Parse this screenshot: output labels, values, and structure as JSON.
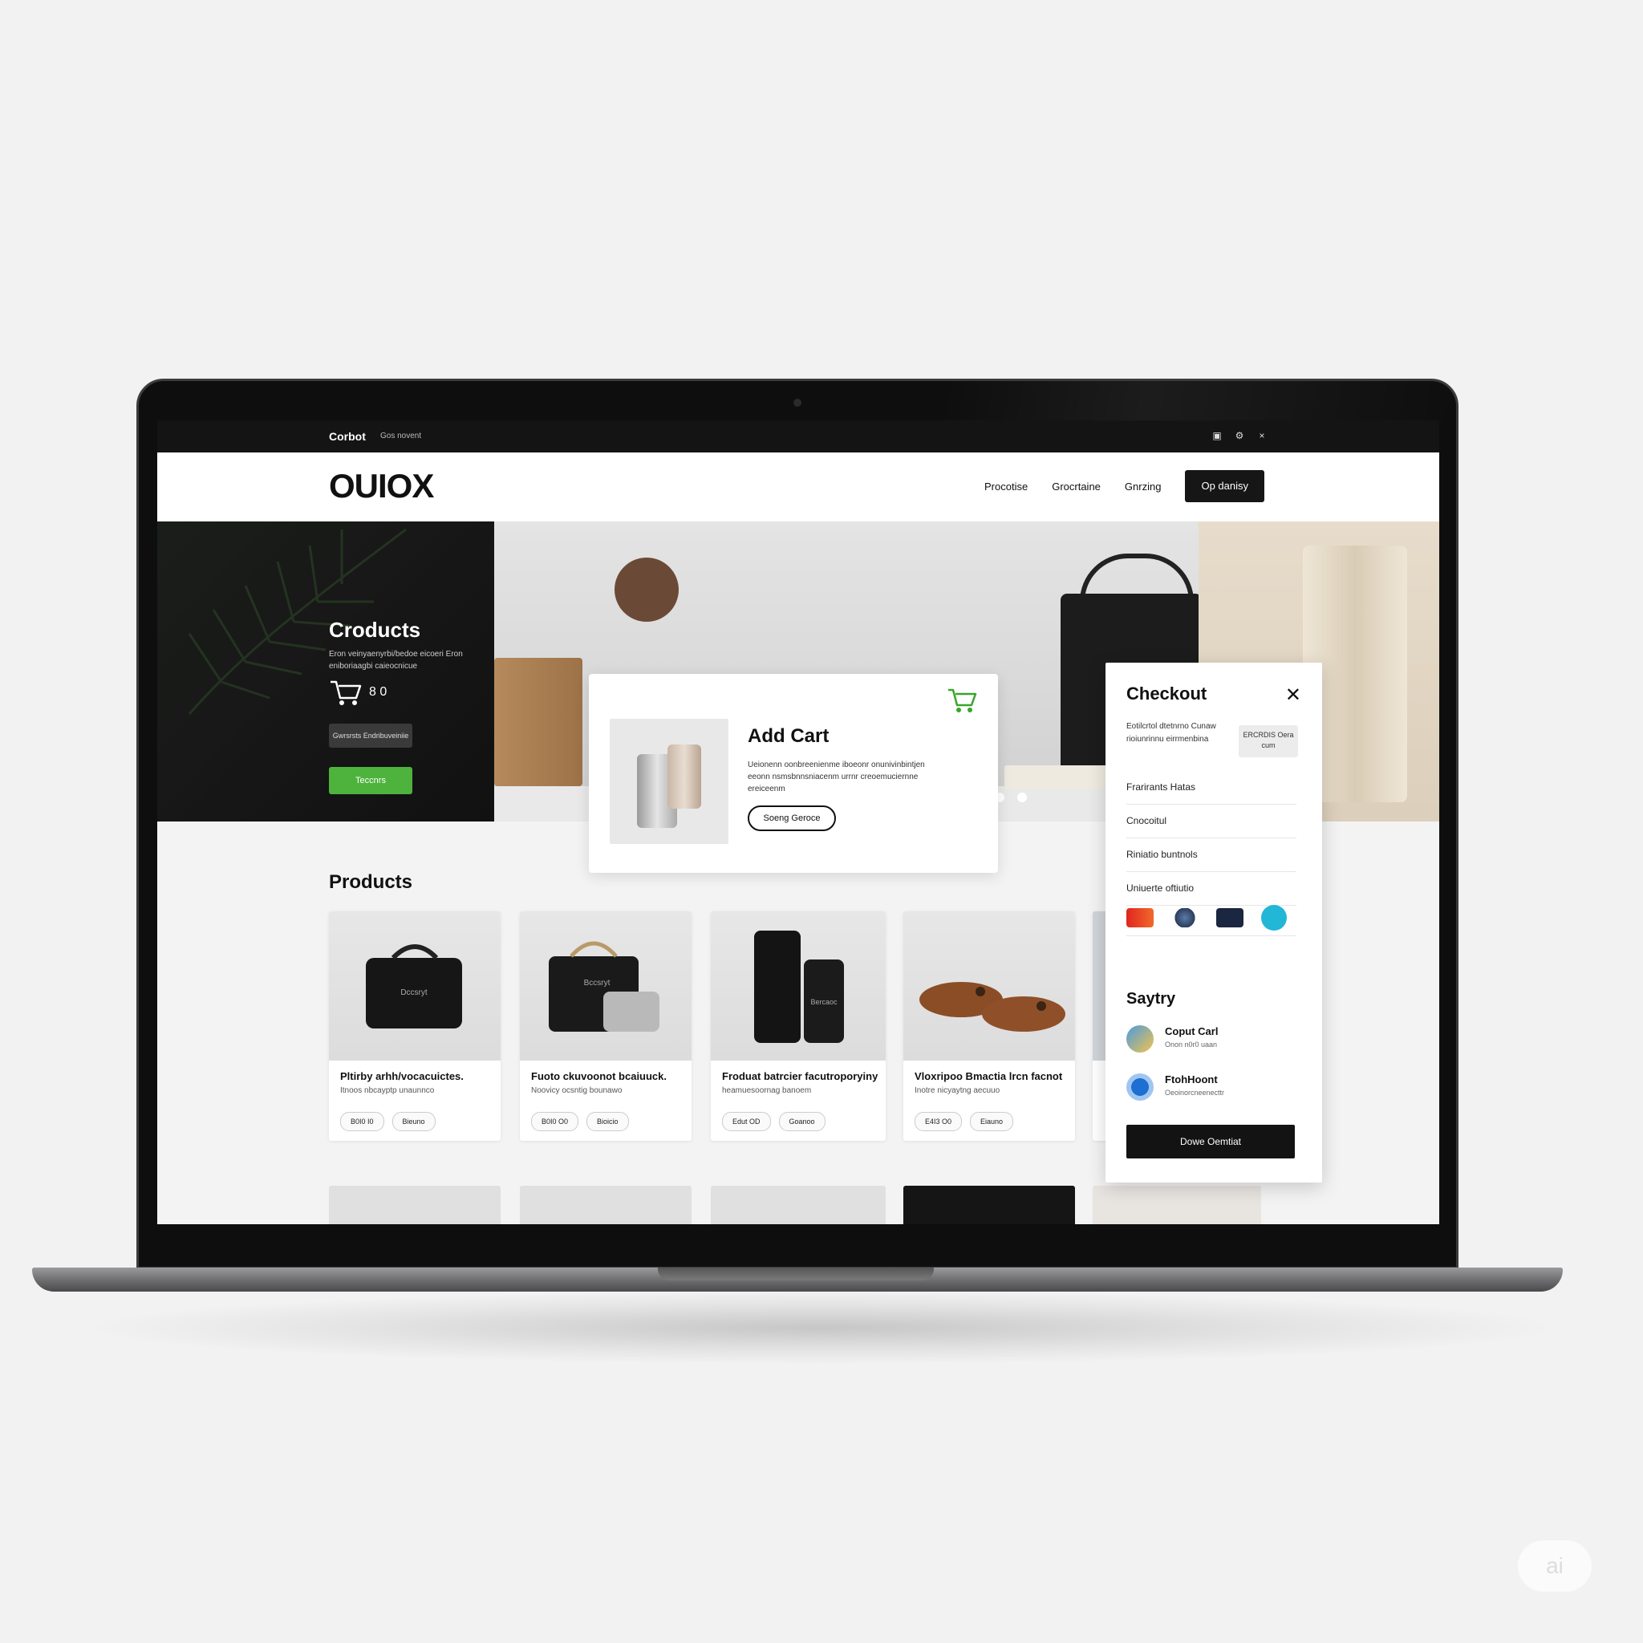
{
  "topbar": {
    "brand": "Corbot",
    "tagline": "Gos novent"
  },
  "header": {
    "logo": "OUIOX",
    "nav": [
      "Procotise",
      "Grocrtaine",
      "Gnrzing"
    ],
    "cta": "Op danisy"
  },
  "hero": {
    "title": "Croducts",
    "subtitle": "Eron veinyaenyrbi/bedoe eicoeri Eron eniboriaagbi caieocnicue",
    "cart_count": "8 0",
    "badge": "Gwrsrsts Endribuveiniie",
    "green_button": "Teccnrs",
    "carousel": {
      "slides": 5,
      "active": 2
    }
  },
  "addcart": {
    "title": "Add Cart",
    "description": "Ueionenn oonbreenienme iboeonr onunivinbintjen eeonn nsmsbnnsniacenm urrnr creoemuciernne ereiceenm",
    "button": "Soeng Geroce"
  },
  "products": {
    "title": "Products",
    "items": [
      {
        "name": "Pltirby arhh/vocacuictes.",
        "sub": "Itnoos nbcayptp unaunnco",
        "price": "B0I0 I0",
        "action": "Bieuno"
      },
      {
        "name": "Fuoto ckuvoonot bcaiuuck.",
        "sub": "Noovicy ocsntig bounawo",
        "price": "B0I0 O0",
        "action": "Bioicio"
      },
      {
        "name": "Froduat batrcier facutroporyiny",
        "sub": "heamuesoornag banoem",
        "price": "Edut OD",
        "action": "Goanoo"
      },
      {
        "name": "Vloxripoo Bmactia lrcn facnot",
        "sub": "Inotre nicyaytng aecuuo",
        "price": "E4I3 O0",
        "action": "Eiauno"
      }
    ]
  },
  "checkout": {
    "title": "Checkout",
    "description": "Eotilcrtol dtetnrno Cunaw rioiunrinnu eirrmenbina",
    "chip": "ERCRDIS Oera cum",
    "rows": [
      "Frarirants Hatas",
      "Cnocoitul",
      "Riniatio buntnols",
      "Uniuerte oftiutio"
    ],
    "payment_icons": [
      "card-red-icon",
      "gpay-icon",
      "card-navy-icon",
      "wallet-cyan-icon"
    ],
    "section_title": "Saytry",
    "items": [
      {
        "name": "Coput Carl",
        "meta": "Onon n0r0 uaan"
      },
      {
        "name": "FtohHoont",
        "meta": "Oeoinorcneenecttr"
      }
    ],
    "button": "Dowe Oemtiat"
  },
  "watermark": "ai"
}
